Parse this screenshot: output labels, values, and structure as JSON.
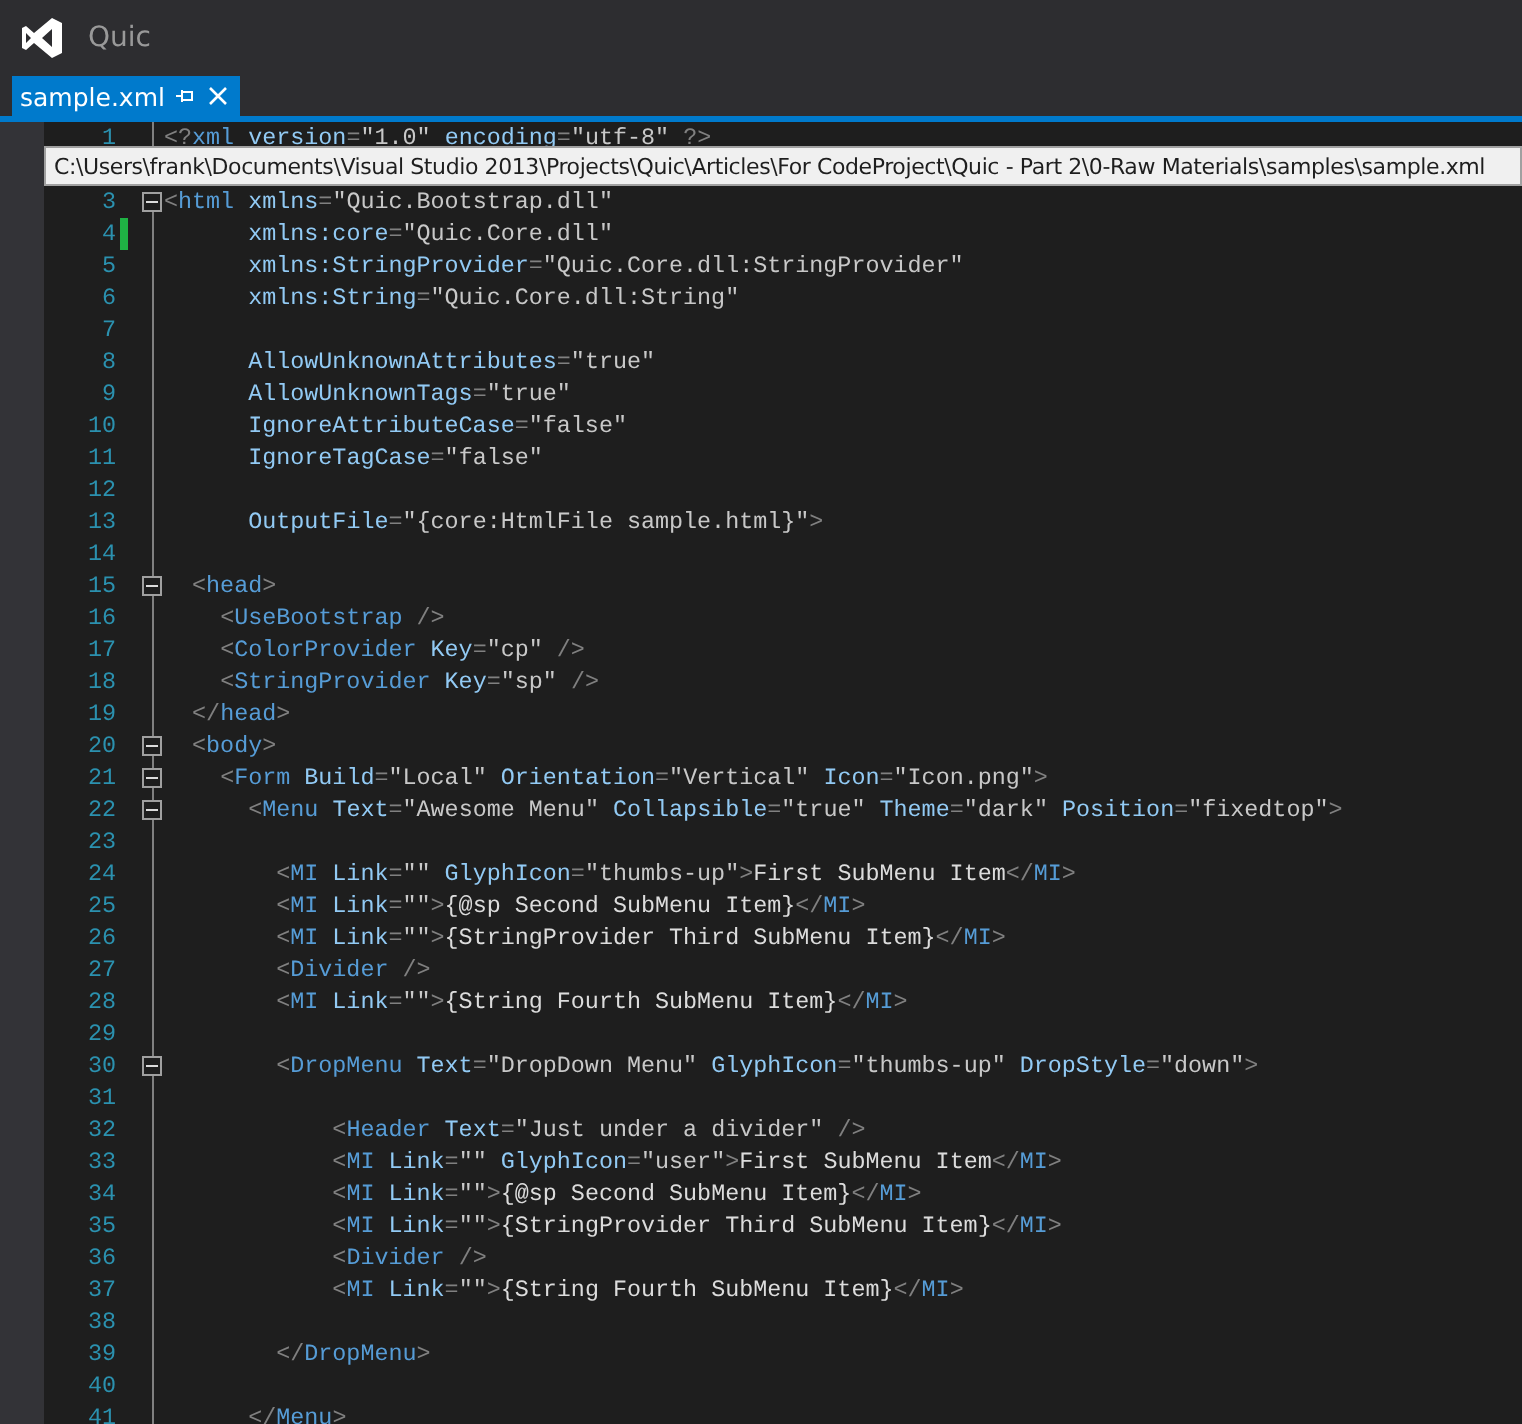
{
  "window": {
    "title": "Quic"
  },
  "tabs": [
    {
      "label": "sample.xml",
      "selected": true,
      "pinned": false
    }
  ],
  "editor": {
    "top_lines": [
      {
        "number": "1",
        "text": "<?xml version=\"1.0\" encoding=\"utf-8\" ?>",
        "fold": false,
        "changed": false
      }
    ],
    "tooltip": "C:\\Users\\frank\\Documents\\Visual Studio 2013\\Projects\\Quic\\Articles\\For CodeProject\\Quic - Part 2\\0-Raw Materials\\samples\\sample.xml",
    "lines": [
      {
        "number": "3",
        "text": "<html xmlns=\"Quic.Bootstrap.dll\"",
        "fold": true,
        "changed": false
      },
      {
        "number": "4",
        "text": "      xmlns:core=\"Quic.Core.dll\"",
        "fold": false,
        "changed": true
      },
      {
        "number": "5",
        "text": "      xmlns:StringProvider=\"Quic.Core.dll:StringProvider\"",
        "fold": false,
        "changed": false
      },
      {
        "number": "6",
        "text": "      xmlns:String=\"Quic.Core.dll:String\"",
        "fold": false,
        "changed": false
      },
      {
        "number": "7",
        "fold": false,
        "changed": false
      },
      {
        "number": "8",
        "text": "      AllowUnknownAttributes=\"true\"",
        "fold": false,
        "changed": false
      },
      {
        "number": "9",
        "text": "      AllowUnknownTags=\"true\"",
        "fold": false,
        "changed": false
      },
      {
        "number": "10",
        "text": "      IgnoreAttributeCase=\"false\"",
        "fold": false,
        "changed": false
      },
      {
        "number": "11",
        "text": "      IgnoreTagCase=\"false\"",
        "fold": false,
        "changed": false
      },
      {
        "number": "12",
        "fold": false,
        "changed": false
      },
      {
        "number": "13",
        "text": "      OutputFile=\"{core:HtmlFile sample.html}\">",
        "fold": false,
        "changed": false
      },
      {
        "number": "14",
        "fold": false,
        "changed": false
      },
      {
        "number": "15",
        "text": "  <head>",
        "fold": true,
        "changed": false
      },
      {
        "number": "16",
        "text": "    <UseBootstrap />",
        "fold": false,
        "changed": false
      },
      {
        "number": "17",
        "text": "    <ColorProvider Key=\"cp\" />",
        "fold": false,
        "changed": false
      },
      {
        "number": "18",
        "text": "    <StringProvider Key=\"sp\" />",
        "fold": false,
        "changed": false
      },
      {
        "number": "19",
        "text": "  </head>",
        "fold": false,
        "changed": false
      },
      {
        "number": "20",
        "text": "  <body>",
        "fold": true,
        "changed": false
      },
      {
        "number": "21",
        "text": "    <Form Build=\"Local\" Orientation=\"Vertical\" Icon=\"Icon.png\">",
        "fold": true,
        "changed": false
      },
      {
        "number": "22",
        "text": "      <Menu Text=\"Awesome Menu\" Collapsible=\"true\" Theme=\"dark\" Position=\"fixedtop\">",
        "fold": true,
        "changed": false
      },
      {
        "number": "23",
        "fold": false,
        "changed": false
      },
      {
        "number": "24",
        "text": "        <MI Link=\"\" GlyphIcon=\"thumbs-up\">First SubMenu Item</MI>",
        "fold": false,
        "changed": false
      },
      {
        "number": "25",
        "text": "        <MI Link=\"\">{@sp Second SubMenu Item}</MI>",
        "fold": false,
        "changed": false
      },
      {
        "number": "26",
        "text": "        <MI Link=\"\">{StringProvider Third SubMenu Item}</MI>",
        "fold": false,
        "changed": false
      },
      {
        "number": "27",
        "text": "        <Divider />",
        "fold": false,
        "changed": false
      },
      {
        "number": "28",
        "text": "        <MI Link=\"\">{String Fourth SubMenu Item}</MI>",
        "fold": false,
        "changed": false
      },
      {
        "number": "29",
        "fold": false,
        "changed": false
      },
      {
        "number": "30",
        "text": "        <DropMenu Text=\"DropDown Menu\" GlyphIcon=\"thumbs-up\" DropStyle=\"down\">",
        "fold": true,
        "changed": false
      },
      {
        "number": "31",
        "fold": false,
        "changed": false
      },
      {
        "number": "32",
        "text": "            <Header Text=\"Just under a divider\" />",
        "fold": false,
        "changed": false
      },
      {
        "number": "33",
        "text": "            <MI Link=\"\" GlyphIcon=\"user\">First SubMenu Item</MI>",
        "fold": false,
        "changed": false
      },
      {
        "number": "34",
        "text": "            <MI Link=\"\">{@sp Second SubMenu Item}</MI>",
        "fold": false,
        "changed": false
      },
      {
        "number": "35",
        "text": "            <MI Link=\"\">{StringProvider Third SubMenu Item}</MI>",
        "fold": false,
        "changed": false
      },
      {
        "number": "36",
        "text": "            <Divider />",
        "fold": false,
        "changed": false
      },
      {
        "number": "37",
        "text": "            <MI Link=\"\">{String Fourth SubMenu Item}</MI>",
        "fold": false,
        "changed": false
      },
      {
        "number": "38",
        "fold": false,
        "changed": false
      },
      {
        "number": "39",
        "text": "        </DropMenu>",
        "fold": false,
        "changed": false
      },
      {
        "number": "40",
        "fold": false,
        "changed": false
      },
      {
        "number": "41",
        "text": "      </Menu>",
        "fold": false,
        "changed": false
      }
    ]
  }
}
